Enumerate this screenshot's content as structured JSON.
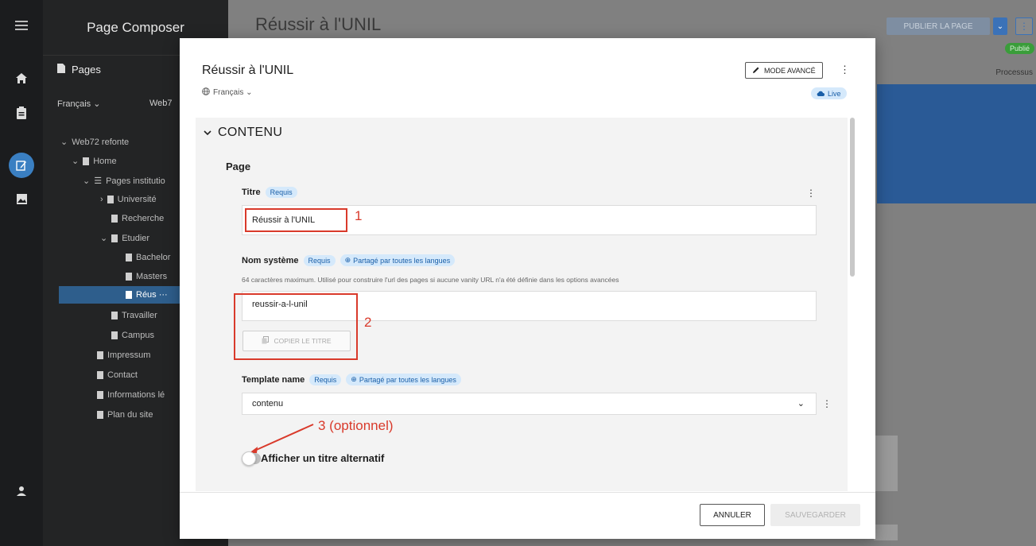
{
  "app": {
    "panel_title": "Page Composer",
    "pages_header": "Pages",
    "language_selector": "Français ⌄",
    "site_selector": "Web7",
    "tree": [
      {
        "label": "Web72 refonte",
        "prefix": "⌄"
      },
      {
        "label": "Home",
        "prefix": "⌄"
      },
      {
        "label": "Pages institutio",
        "prefix": "⌄"
      },
      {
        "label": "Université",
        "prefix": "›"
      },
      {
        "label": "Recherche",
        "prefix": ""
      },
      {
        "label": "Etudier",
        "prefix": "⌄"
      },
      {
        "label": "Bachelor",
        "prefix": ""
      },
      {
        "label": "Masters",
        "prefix": ""
      },
      {
        "label": "Réus  ···",
        "prefix": ""
      },
      {
        "label": "Travailler",
        "prefix": ""
      },
      {
        "label": "Campus",
        "prefix": ""
      },
      {
        "label": "Impressum",
        "prefix": ""
      },
      {
        "label": "Contact",
        "prefix": ""
      },
      {
        "label": "Informations lé",
        "prefix": ""
      },
      {
        "label": "Plan du site",
        "prefix": ""
      }
    ]
  },
  "background_page": {
    "title": "Réussir à l'UNIL",
    "publish_label": "PUBLIER LA PAGE",
    "status": "Publié",
    "processus": "Processus"
  },
  "modal": {
    "title": "Réussir à l'UNIL",
    "language": "Français ⌄",
    "mode_button": "MODE AVANCÉ",
    "live_badge": "Live",
    "section_title": "CONTENU",
    "group_title": "Page",
    "fields": {
      "titre": {
        "label": "Titre",
        "badge": "Requis",
        "value": "Réussir à l'UNIL"
      },
      "nom_systeme": {
        "label": "Nom système",
        "badge": "Requis",
        "shared_badge": "Partagé par toutes les langues",
        "help": "64 caractères maximum. Utilisé pour construire l'url des pages si aucune vanity URL n'a été définie dans les options avancées",
        "value": "reussir-a-l-unil",
        "copy_button": "COPIER LE TITRE"
      },
      "template": {
        "label": "Template name",
        "badge": "Requis",
        "shared_badge": "Partagé par toutes les langues",
        "value": "contenu"
      },
      "alt_title_toggle": {
        "label": "Afficher un titre alternatif",
        "on": false
      }
    },
    "annotations": {
      "n1": "1",
      "n2": "2",
      "n3": "3 (optionnel)"
    },
    "cancel_button": "ANNULER",
    "save_button": "SAUVEGARDER"
  },
  "colors": {
    "accent": "#1a5fa8",
    "annotation": "#d93a2b"
  }
}
